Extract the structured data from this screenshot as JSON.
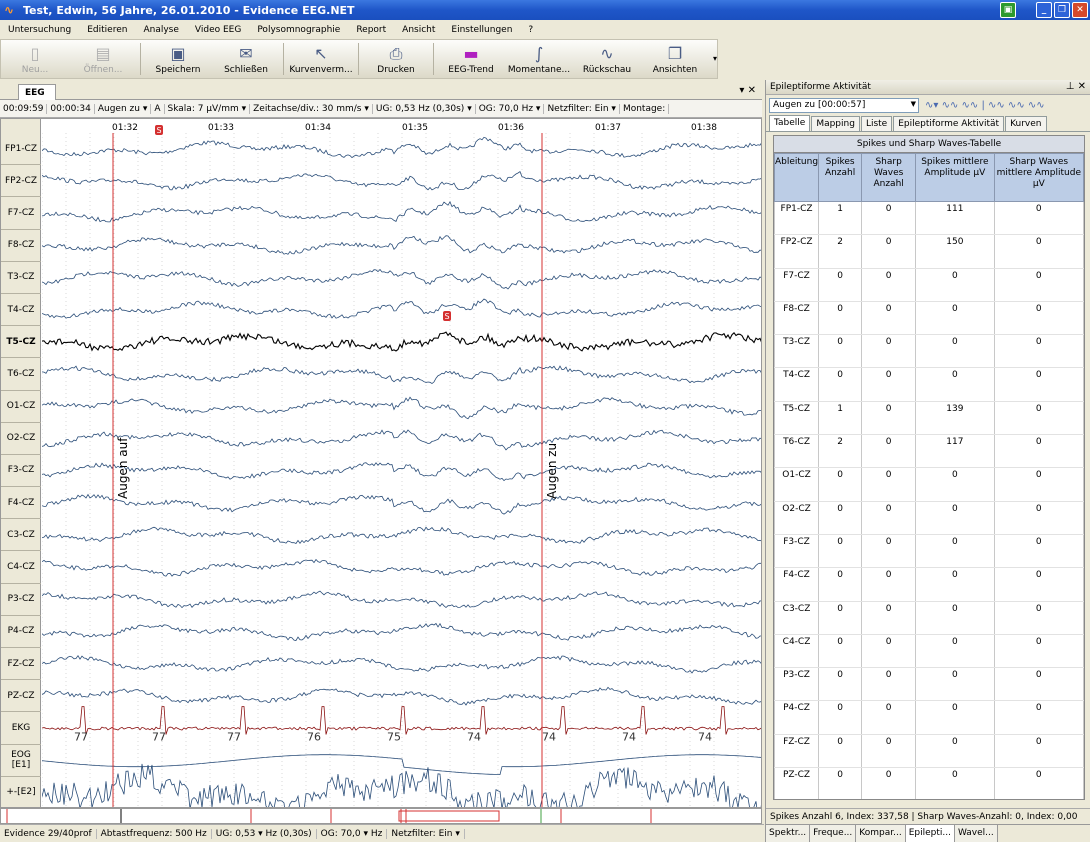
{
  "window": {
    "title": "Test, Edwin, 56 Jahre, 26.01.2010 - Evidence EEG.NET"
  },
  "menu": [
    "Untersuchung",
    "Editieren",
    "Analyse",
    "Video EEG",
    "Polysomnographie",
    "Report",
    "Ansicht",
    "Einstellungen",
    "?"
  ],
  "toolbar": [
    {
      "label": "Neu...",
      "icon": "new-icon",
      "enabled": false
    },
    {
      "label": "Öffnen...",
      "icon": "open-icon",
      "enabled": false
    },
    {
      "label": "Speichern",
      "icon": "save-icon",
      "enabled": true
    },
    {
      "label": "Schließen",
      "icon": "close-file-icon",
      "enabled": true
    },
    {
      "label": "Kurvenverm...",
      "icon": "cursor-icon",
      "enabled": true
    },
    {
      "label": "Drucken",
      "icon": "print-icon",
      "enabled": true
    },
    {
      "label": "EEG-Trend",
      "icon": "trend-icon",
      "enabled": true
    },
    {
      "label": "Momentane...",
      "icon": "momentary-icon",
      "enabled": true
    },
    {
      "label": "Rückschau",
      "icon": "review-icon",
      "enabled": true
    },
    {
      "label": "Ansichten",
      "icon": "views-icon",
      "enabled": true
    }
  ],
  "eeg_tab": {
    "label": "EEG"
  },
  "params": {
    "time": "00:09:59",
    "duration": "00:00:34",
    "event": "Augen zu",
    "a": "A",
    "scale": "Skala:  7 µV/mm",
    "timebase": "Zeitachse/div.:  30 mm/s",
    "ug": "UG:  0,53 Hz (0,30s)",
    "og": "OG:  70,0 Hz",
    "notch": "Netzfilter:  Ein",
    "montage": "Montage:"
  },
  "time_ticks": [
    "01:32",
    "01:33",
    "01:34",
    "01:35",
    "01:36",
    "01:37",
    "01:38"
  ],
  "channels": [
    "FP1-CZ",
    "FP2-CZ",
    "F7-CZ",
    "F8-CZ",
    "T3-CZ",
    "T4-CZ",
    "T5-CZ",
    "T6-CZ",
    "O1-CZ",
    "O2-CZ",
    "F3-CZ",
    "F4-CZ",
    "C3-CZ",
    "C4-CZ",
    "P3-CZ",
    "P4-CZ",
    "FZ-CZ",
    "PZ-CZ",
    "EKG",
    "EOG [E1]",
    "+-[E2]"
  ],
  "selected_channel": "T5-CZ",
  "markers": [
    {
      "label": "Augen auf"
    },
    {
      "label": "Augen zu"
    }
  ],
  "spike_marks": [
    "S",
    "S"
  ],
  "heart_rates": [
    "77",
    "77",
    "77",
    "76",
    "75",
    "74",
    "74",
    "74",
    "74"
  ],
  "colors": {
    "eeg": "#2a4d78",
    "selected": "#000000",
    "ekg": "#8a1010",
    "marker": "#d43030",
    "header": "#bccde6"
  },
  "statusbar": {
    "version": "Evidence 29/40prof",
    "rate": "Abtastfrequenz: 500 Hz",
    "ug": "UG:  0,53  ▾  Hz  (0,30s)",
    "og": "OG:  70,0  ▾  Hz",
    "notch": "Netzfilter:  Ein  ▾"
  },
  "panel": {
    "title": "Epileptiforme Aktivität",
    "selector": "Augen zu [00:00:57]",
    "tabs": [
      "Tabelle",
      "Mapping",
      "Liste",
      "Epileptiforme Aktivität",
      "Kurven"
    ],
    "table_title": "Spikes und Sharp Waves-Tabelle",
    "columns": [
      "Ableitung",
      "Spikes Anzahl",
      "Sharp Waves Anzahl",
      "Spikes mittlere Amplitude µV",
      "Sharp Waves mittlere Amplitude µV"
    ],
    "rows": [
      [
        "FP1-CZ",
        "1",
        "0",
        "111",
        "0"
      ],
      [
        "FP2-CZ",
        "2",
        "0",
        "150",
        "0"
      ],
      [
        "F7-CZ",
        "0",
        "0",
        "0",
        "0"
      ],
      [
        "F8-CZ",
        "0",
        "0",
        "0",
        "0"
      ],
      [
        "T3-CZ",
        "0",
        "0",
        "0",
        "0"
      ],
      [
        "T4-CZ",
        "0",
        "0",
        "0",
        "0"
      ],
      [
        "T5-CZ",
        "1",
        "0",
        "139",
        "0"
      ],
      [
        "T6-CZ",
        "2",
        "0",
        "117",
        "0"
      ],
      [
        "O1-CZ",
        "0",
        "0",
        "0",
        "0"
      ],
      [
        "O2-CZ",
        "0",
        "0",
        "0",
        "0"
      ],
      [
        "F3-CZ",
        "0",
        "0",
        "0",
        "0"
      ],
      [
        "F4-CZ",
        "0",
        "0",
        "0",
        "0"
      ],
      [
        "C3-CZ",
        "0",
        "0",
        "0",
        "0"
      ],
      [
        "C4-CZ",
        "0",
        "0",
        "0",
        "0"
      ],
      [
        "P3-CZ",
        "0",
        "0",
        "0",
        "0"
      ],
      [
        "P4-CZ",
        "0",
        "0",
        "0",
        "0"
      ],
      [
        "FZ-CZ",
        "0",
        "0",
        "0",
        "0"
      ],
      [
        "PZ-CZ",
        "0",
        "0",
        "0",
        "0"
      ]
    ],
    "status": "Spikes Anzahl  6, Index: 337,58  |  Sharp Waves-Anzahl:  0, Index: 0,00",
    "bottom_tabs": [
      "Spektr...",
      "Freque...",
      "Kompar...",
      "Epilepti...",
      "Wavel..."
    ]
  }
}
